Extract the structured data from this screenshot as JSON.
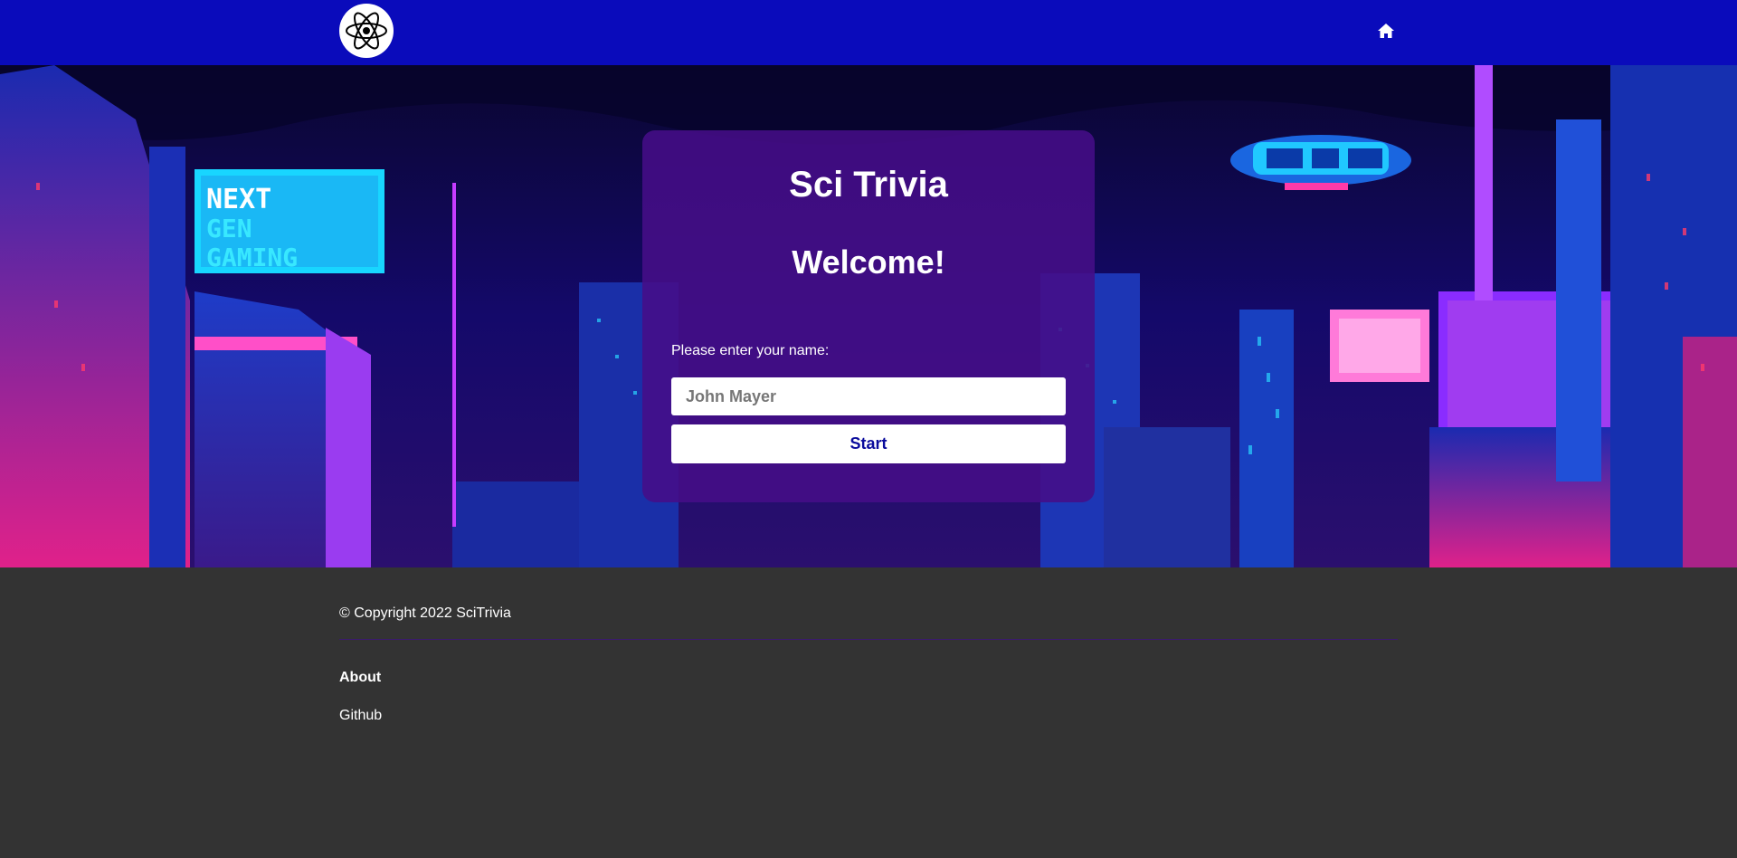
{
  "navbar": {
    "logo_icon": "atom-icon",
    "home_icon": "home-icon"
  },
  "card": {
    "title": "Sci Trivia",
    "welcome": "Welcome!",
    "name_label": "Please enter your name:",
    "name_placeholder": "John Mayer",
    "name_value": "",
    "start_label": "Start"
  },
  "footer": {
    "copyright": "© Copyright 2022 SciTrivia",
    "about_label": "About",
    "github_label": "Github"
  },
  "colors": {
    "navbar": "#0a0bbb",
    "card": "#460e87",
    "footer": "#333333",
    "start_text": "#0a0b9c"
  }
}
